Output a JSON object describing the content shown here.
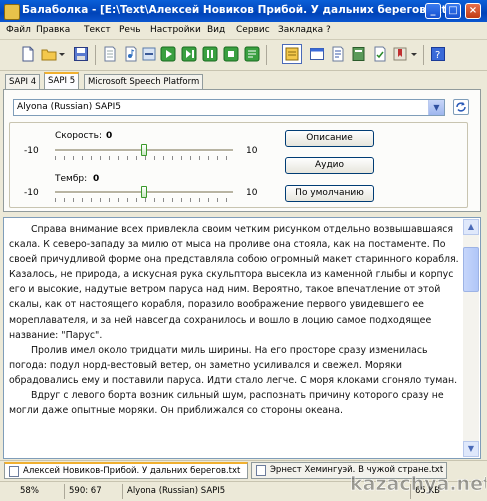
{
  "window": {
    "title": "Балаболка - [E:\\Text\\Алексей Новиков Прибой. У дальних берегов.txt]",
    "buttons": {
      "minimize": "_",
      "maximize": "□",
      "close": "×"
    }
  },
  "menu": [
    "Файл",
    "Правка",
    "Текст",
    "Речь",
    "Настройки",
    "Вид",
    "Сервис",
    "Закладка",
    "?"
  ],
  "voice_tabs": [
    "SAPI 4",
    "SAPI 5",
    "Microsoft Speech Platform"
  ],
  "voice": {
    "selected": "Alyona (Russian) SAPI5",
    "speed": {
      "label": "Скорость:",
      "value": "0",
      "min": "-10",
      "max": "10",
      "level": 0.5
    },
    "pitch": {
      "label": "Тембр:",
      "value": "0",
      "min": "-10",
      "max": "10",
      "level": 0.5
    },
    "buttons": [
      "Описание",
      "Аудио",
      "По умолчанию"
    ]
  },
  "document": {
    "paragraphs": [
      "Справа внимание всех привлекла своим четким рисунком отдельно возвышавшаяся скала. К северо-западу за милю от мыса на проливе она стояла, как на постаменте. По своей причудливой форме она представляла собою огромный макет старинного корабля. Казалось, не природа, а искусная рука скульптора высекла из каменной глыбы и корпус его и высокие, надутые ветром паруса над ним. Вероятно, такое впечатление от этой скалы, как от настоящего корабля, поразило воображение первого увидевшего ее мореплавателя, и за ней навсегда сохранилось и вошло в лоцию самое подходящее название: \"Парус\".",
      "Пролив имел около тридцати миль ширины. На его просторе сразу изменилась погода: подул норд-вестовый ветер, он заметно усиливался и свежел. Моряки обрадовались ему и поставили паруса. Идти стало легче. С моря клоками сгоняло туман.",
      "Вдруг с левого борта возник сильный шум, распознать причину которого сразу не могли даже опытные моряки. Он приближался со стороны океана."
    ]
  },
  "doc_tabs": [
    "Алексей Новиков-Прибой. У дальних берегов.txt",
    "Эрнест Хемингуэй. В чужой стране.txt"
  ],
  "status": {
    "zoom": "58%",
    "position": "590:  67",
    "voice": "Alyona (Russian) SAPI5",
    "size": "65 KB"
  },
  "watermark": "kazachya.net",
  "colors": {
    "title_bar": "#0a5fd8",
    "tab_accent": "#f0b030",
    "slider_thumb": "#3b9a2b"
  }
}
